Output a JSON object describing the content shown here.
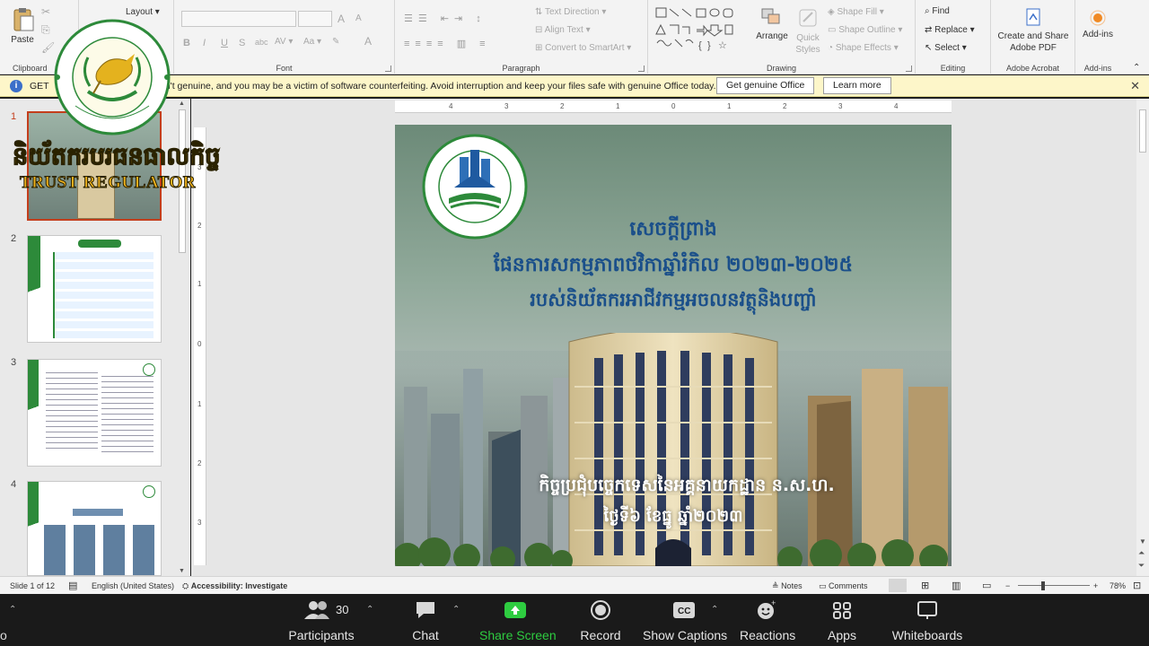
{
  "ribbon": {
    "clipboard": {
      "label": "Clipboard",
      "paste": "Paste"
    },
    "slides": {
      "layout": "Layout"
    },
    "font": {
      "label": "Font",
      "bold": "B",
      "italic": "I",
      "underline": "U",
      "strike": "S",
      "shadow": "abc",
      "grow": "A",
      "shrink": "A",
      "clear": "A"
    },
    "paragraph": {
      "label": "Paragraph",
      "text_direction": "Text Direction",
      "align_text": "Align Text",
      "convert_smartart": "Convert to SmartArt"
    },
    "drawing": {
      "label": "Drawing",
      "arrange": "Arrange",
      "quick_styles": "Quick Styles",
      "shape_fill": "Shape Fill",
      "shape_outline": "Shape Outline",
      "shape_effects": "Shape Effects"
    },
    "editing": {
      "label": "Editing",
      "find": "Find",
      "replace": "Replace",
      "select": "Select"
    },
    "acrobat": {
      "label": "Adobe Acrobat",
      "create_share": "Create and Share Adobe PDF"
    },
    "addins": {
      "label": "Add-ins",
      "addins": "Add-ins"
    }
  },
  "infobar": {
    "prefix": "GET",
    "message": "sn't genuine, and you may be a victim of software counterfeiting. Avoid interruption and keep your files safe with genuine Office today.",
    "get_genuine": "Get genuine Office",
    "learn_more": "Learn more"
  },
  "thumbnails": [
    {
      "num": "1"
    },
    {
      "num": "2"
    },
    {
      "num": "3"
    },
    {
      "num": "4"
    }
  ],
  "ruler": {
    "h": [
      "4",
      "3",
      "2",
      "1",
      "0",
      "1",
      "2",
      "3",
      "4"
    ],
    "v": [
      "3",
      "2",
      "1",
      "0",
      "1",
      "2",
      "3"
    ]
  },
  "slide": {
    "line1": "សេចក្តីព្រាង",
    "line2": "ផែនការសកម្មភាពថវិកាឆ្នាំរំកិល ២០២៣-២០២៥",
    "line3": "របស់និយ័តករអាជីវកម្មអចលនវត្ថុនិងបញ្ចាំ",
    "line4": "កិច្ចប្រជុំបច្ចេកទេសនៃអគ្គនាយកដ្ឋាន ន.ស.ហ.",
    "line5": "ថ្ងៃទី៦ ខែធ្នូ ឆ្នាំ២០២៣"
  },
  "status": {
    "slide_of": "Slide 1 of 12",
    "language": "English (United States)",
    "accessibility": "Accessibility: Investigate",
    "notes": "Notes",
    "comments": "Comments",
    "zoom": "78%"
  },
  "meeting": {
    "participants": "Participants",
    "participant_count": "30",
    "chat": "Chat",
    "share": "Share Screen",
    "record": "Record",
    "captions": "Show Captions",
    "reactions": "Reactions",
    "apps": "Apps",
    "whiteboards": "Whiteboards"
  },
  "watermark": {
    "khmer": "និយ័តករបរធនធាលកិច្ច",
    "english": "TRUST REGULATOR"
  },
  "colors": {
    "accent": "#c43e1c",
    "share_green": "#2ecc40",
    "slide_title": "#1a4f8a"
  }
}
